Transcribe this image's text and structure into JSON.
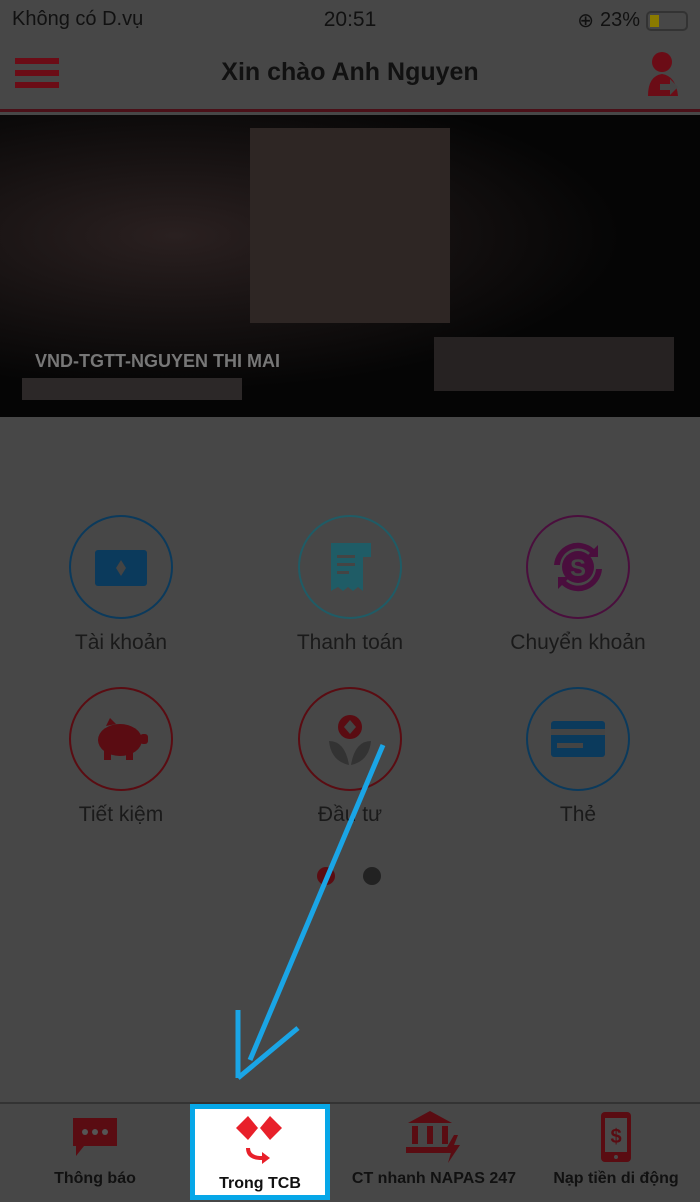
{
  "status_bar": {
    "carrier": "Không có D.vụ",
    "time": "20:51",
    "battery": "23%",
    "battery_level": 0.23
  },
  "header": {
    "title": "Xin chào Anh Nguyen",
    "menu_icon": "hamburger-icon",
    "user_icon": "user-logout-icon"
  },
  "banner": {
    "account_name": "VND-TGTT-NGUYEN THI MAI"
  },
  "menu": [
    {
      "label": "Tài khoản",
      "icon": "wallet-icon",
      "color": "#0b3a5c"
    },
    {
      "label": "Thanh toán",
      "icon": "receipt-icon",
      "color": "#1f5c66"
    },
    {
      "label": "Chuyển khoản",
      "icon": "money-exchange-icon",
      "color": "#4a0e3d"
    },
    {
      "label": "Tiết kiệm",
      "icon": "piggy-bank-icon",
      "color": "#5a0c12"
    },
    {
      "label": "Đầu tư",
      "icon": "investment-icon",
      "color": "#5a0c12"
    },
    {
      "label": "Thẻ",
      "icon": "card-icon",
      "color": "#0b3a5c"
    }
  ],
  "pagination": {
    "current": 1,
    "total": 2
  },
  "tabs": [
    {
      "label": "Thông báo",
      "icon": "chat-icon"
    },
    {
      "label": "Trong TCB",
      "icon": "tcb-transfer-icon",
      "selected": true
    },
    {
      "label": "CT nhanh NAPAS 247",
      "icon": "bank-fast-icon"
    },
    {
      "label": "Nạp tiền di động",
      "icon": "phone-topup-icon"
    }
  ],
  "colors": {
    "brand": "#e8202a",
    "highlight": "#06a7e8"
  }
}
